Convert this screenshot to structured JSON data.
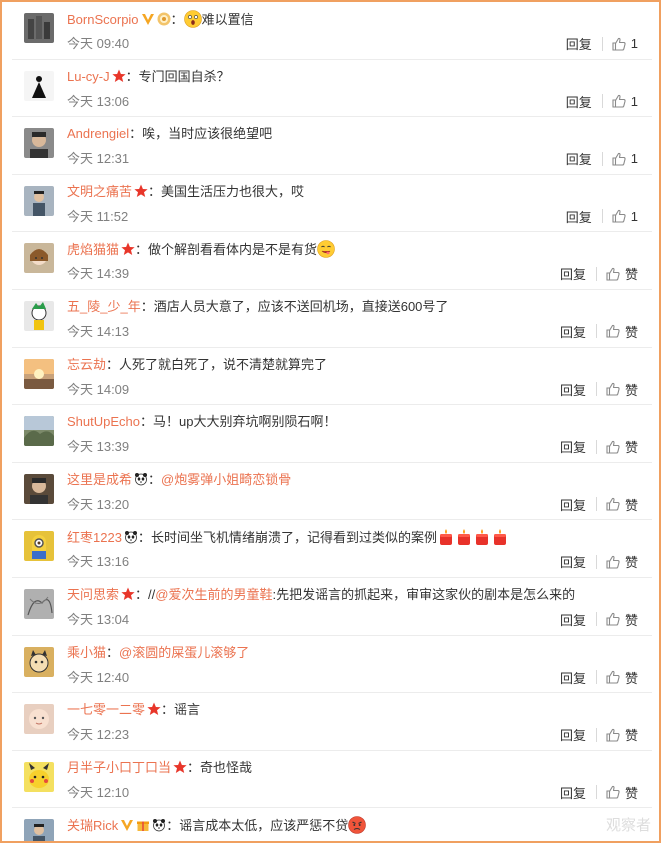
{
  "comments": [
    {
      "user": "BornScorpio",
      "avatar": "city-photo",
      "badges": [
        "verified-v",
        "crown"
      ],
      "text": "难以置信",
      "pre_emoji": "shocked-face",
      "time": "今天 09:40",
      "reply": "回复",
      "like": "1",
      "bg": "#6b6b6b"
    },
    {
      "user": "Lu-cy-J",
      "avatar": "dancer",
      "badges": [
        "star"
      ],
      "text": "专门回国自杀？",
      "time": "今天 13:06",
      "reply": "回复",
      "like": "1",
      "bg": "#f5f5f5"
    },
    {
      "user": "Andrengiel",
      "avatar": "man-portrait",
      "badges": [],
      "text": "唉，当时应该很绝望吧",
      "time": "今天 12:31",
      "reply": "回复",
      "like": "1",
      "bg": "#8a8a8a"
    },
    {
      "user": "文明之痛苦",
      "avatar": "person-outdoor",
      "badges": [
        "star"
      ],
      "text": "美国生活压力也很大，哎",
      "time": "今天 11:52",
      "reply": "回复",
      "like": "1",
      "bg": "#a8b4c0"
    },
    {
      "user": "虎焰猫猫",
      "avatar": "anime-girl",
      "badges": [
        "star"
      ],
      "text": "做个解剖看看体内是不是有货",
      "post_emoji": "yummy-face",
      "time": "今天 14:39",
      "reply": "回复",
      "like": "赞",
      "bg": "#c9b79a"
    },
    {
      "user": "五_陵_少_年",
      "avatar": "cartoon-boy",
      "badges": [],
      "text": "酒店人员大意了，应该不送回机场，直接送600号了",
      "time": "今天 14:13",
      "reply": "回复",
      "like": "赞",
      "bg": "#e8e8e8"
    },
    {
      "user": "忘云劫",
      "avatar": "sunset",
      "badges": [],
      "text": "人死了就白死了，说不清楚就算完了",
      "time": "今天 14:09",
      "reply": "回复",
      "like": "赞",
      "bg": "#c9a27a"
    },
    {
      "user": "ShutUpEcho",
      "avatar": "landscape",
      "badges": [],
      "text": "马！up大大别弃坑啊别陨石啊！",
      "time": "今天 13:39",
      "reply": "回复",
      "like": "赞",
      "bg": "#7c8a6a"
    },
    {
      "user": "这里是成希",
      "avatar": "man-portrait-2",
      "badges": [
        "panda"
      ],
      "mention": "@炮雾弹小姐畸恋锁骨",
      "text": "",
      "time": "今天 13:20",
      "reply": "回复",
      "like": "赞",
      "bg": "#5a4a3a"
    },
    {
      "user": "红枣1223",
      "avatar": "minion",
      "badges": [
        "panda"
      ],
      "text": "长时间坐飞机情绪崩溃了，记得看到过类似的案例",
      "post_emoji": "candles",
      "time": "今天 13:16",
      "reply": "回复",
      "like": "赞",
      "bg": "#e6c23a"
    },
    {
      "user": "天问思索",
      "avatar": "sketch",
      "badges": [
        "star"
      ],
      "text_prefix": "//",
      "mention": "@爱次生前的男童鞋",
      "text": ":先把发谣言的抓起来，审审这家伙的剧本是怎么来的",
      "time": "今天 13:04",
      "reply": "回复",
      "like": "赞",
      "bg": "#b0b0b0"
    },
    {
      "user": "乘小猫",
      "avatar": "cartoon-cat",
      "badges": [],
      "mention": "@滚圆的屎蛋儿滚够了",
      "text": "",
      "time": "今天 12:40",
      "reply": "回复",
      "like": "赞",
      "bg": "#d9b060"
    },
    {
      "user": "一七零一二零",
      "avatar": "baby",
      "badges": [
        "star"
      ],
      "text": "谣言",
      "time": "今天 12:23",
      "reply": "回复",
      "like": "赞",
      "bg": "#e8cfc0"
    },
    {
      "user": "月半子小口丁口当",
      "avatar": "pikachu",
      "badges": [
        "star"
      ],
      "text": "奇也怪哉",
      "time": "今天 12:10",
      "reply": "回复",
      "like": "赞",
      "bg": "#f4e060"
    },
    {
      "user": "关瑞Rick",
      "avatar": "person-cap",
      "badges": [
        "verified-v",
        "gift",
        "panda"
      ],
      "text": "谣言成本太低，应该严惩不贷",
      "post_emoji": "angry-face",
      "time": "",
      "reply": "",
      "like": "",
      "bg": "#8fa4b8"
    }
  ],
  "watermark": "观察者"
}
